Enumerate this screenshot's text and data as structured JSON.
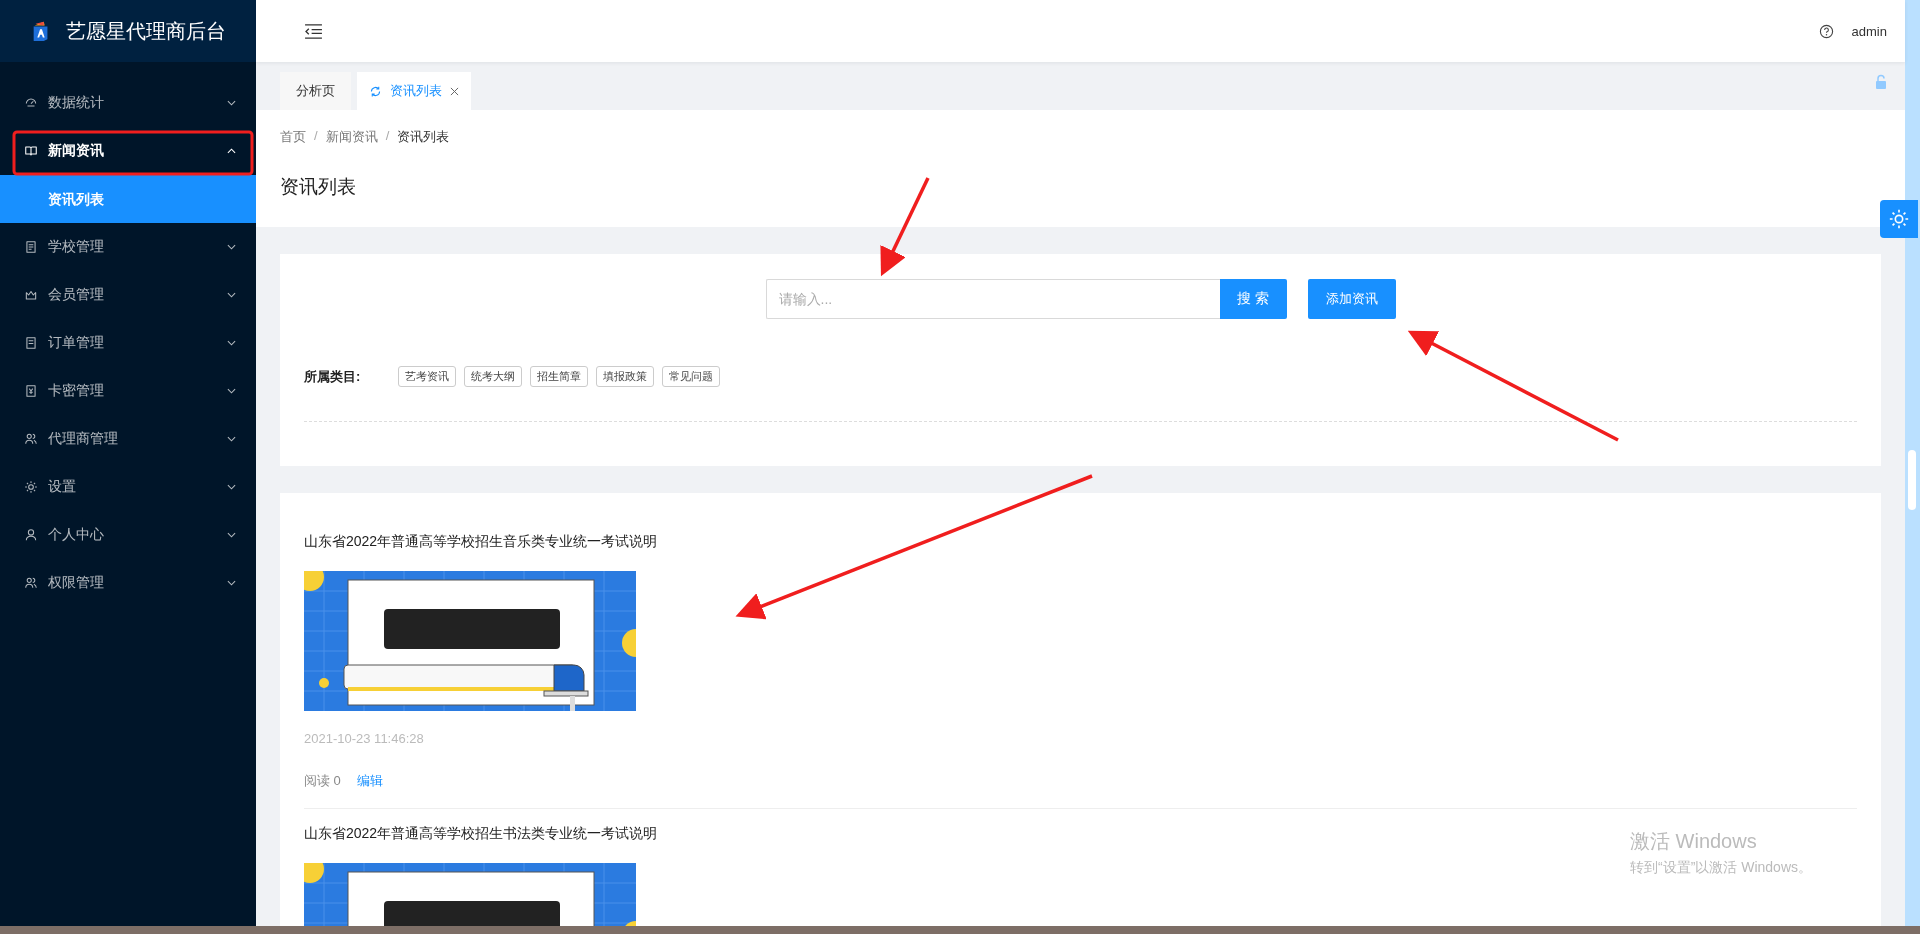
{
  "brand": {
    "title": "艺愿星代理商后台"
  },
  "sidebar": {
    "items": [
      {
        "label": "数据统计",
        "expanded": false
      },
      {
        "label": "新闻资讯",
        "expanded": true,
        "children": [
          {
            "label": "资讯列表",
            "selected": true
          }
        ]
      },
      {
        "label": "学校管理",
        "expanded": false
      },
      {
        "label": "会员管理",
        "expanded": false
      },
      {
        "label": "订单管理",
        "expanded": false
      },
      {
        "label": "卡密管理",
        "expanded": false
      },
      {
        "label": "代理商管理",
        "expanded": false
      },
      {
        "label": "设置",
        "expanded": false
      },
      {
        "label": "个人中心",
        "expanded": false
      },
      {
        "label": "权限管理",
        "expanded": false
      }
    ]
  },
  "header": {
    "user": "admin"
  },
  "tabs": [
    {
      "label": "分析页",
      "selected": false
    },
    {
      "label": "资讯列表",
      "selected": true
    }
  ],
  "breadcrumb": {
    "separator": "/",
    "items": [
      "首页",
      "新闻资讯",
      "资讯列表"
    ]
  },
  "page_title": "资讯列表",
  "search": {
    "placeholder": "请输入...",
    "button": "搜 索",
    "add_button": "添加资讯"
  },
  "categories": {
    "label": "所属类目:",
    "tags": [
      "艺考资讯",
      "统考大纲",
      "招生简章",
      "填报政策",
      "常见问题"
    ]
  },
  "articles": [
    {
      "title": "山东省2022年普通高等学校招生音乐类专业统一考试说明",
      "date": "2021-10-23 11:46:28",
      "reads": "阅读 0",
      "edit": "编辑"
    },
    {
      "title": "山东省2022年普通高等学校招生书法类专业统一考试说明"
    }
  ],
  "os_notice": {
    "title": "激活 Windows",
    "subtitle": "转到“设置”以激活 Windows。"
  }
}
